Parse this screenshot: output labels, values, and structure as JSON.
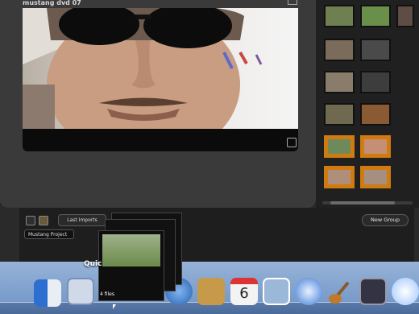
{
  "viewer": {
    "title": "mustang dvd 07"
  },
  "toolbar": {
    "last_imports_label": "Last Imports",
    "new_group_label": "New Group"
  },
  "project": {
    "name": "Mustang Project"
  },
  "drag": {
    "label": "Quic",
    "files_label": "4 files"
  },
  "dock": {
    "calendar_day": "6"
  },
  "colors": {
    "accent": "#d07a12",
    "panel": "#3a3a3a",
    "dock": "#7f9fcf"
  },
  "icons": [
    "resize-icon",
    "fullscreen-icon",
    "finder-icon",
    "mail-icon",
    "safari-icon",
    "address-book-icon",
    "ical-icon",
    "iphoto-icon",
    "itunes-icon",
    "garageband-icon",
    "expose-icon",
    "ichat-icon"
  ]
}
